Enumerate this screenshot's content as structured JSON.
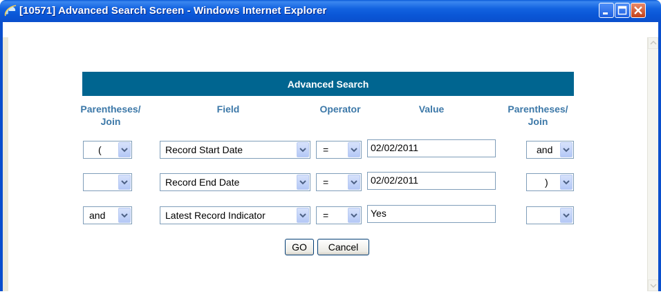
{
  "window": {
    "title": "[10571] Advanced Search Screen - Windows Internet Explorer"
  },
  "search": {
    "header": "Advanced Search",
    "columns": {
      "join_left": [
        "Parentheses/",
        "Join"
      ],
      "field": "Field",
      "operator": "Operator",
      "value": "Value",
      "join_right": [
        "Parentheses/",
        "Join"
      ]
    },
    "rows": [
      {
        "left": "(",
        "field": "Record Start Date",
        "operator": "=",
        "value": "02/02/2011",
        "right": "and"
      },
      {
        "left": "",
        "field": "Record End Date",
        "operator": "=",
        "value": "02/02/2011",
        "right": ")"
      },
      {
        "left": "and",
        "field": "Latest Record Indicator",
        "operator": "=",
        "value": "Yes",
        "right": ""
      }
    ],
    "buttons": {
      "go": "GO",
      "cancel": "Cancel"
    }
  },
  "colors": {
    "header_bg": "#006590",
    "column_text": "#3c78a8",
    "titlebar": "#0a56d6"
  }
}
